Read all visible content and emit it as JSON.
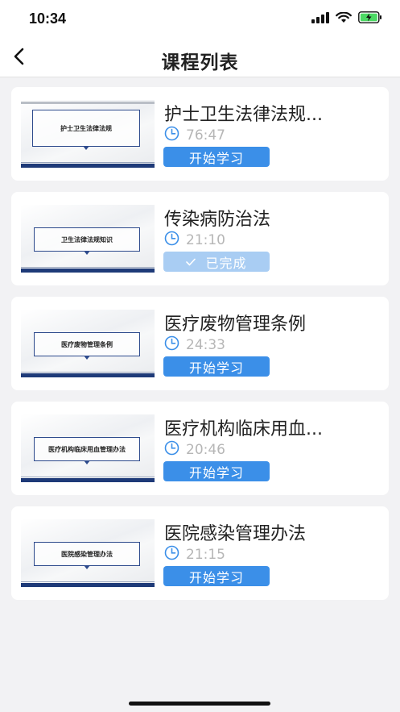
{
  "status_bar": {
    "time": "10:34"
  },
  "nav": {
    "title": "课程列表",
    "back_icon": "chevron-left-icon"
  },
  "courses": [
    {
      "thumb_text": "护士卫生法律法规",
      "title": "护士卫生法律法规...",
      "duration": "76:47",
      "action": "开始学习",
      "completed": false
    },
    {
      "thumb_text": "卫生法律法规知识",
      "title": "传染病防治法",
      "duration": "21:10",
      "action": "已完成",
      "completed": true
    },
    {
      "thumb_text": "医疗废物管理条例",
      "title": "医疗废物管理条例",
      "duration": "24:33",
      "action": "开始学习",
      "completed": false
    },
    {
      "thumb_text": "医疗机构临床用血管理办法",
      "title": "医疗机构临床用血...",
      "duration": "20:46",
      "action": "开始学习",
      "completed": false
    },
    {
      "thumb_text": "医院感染管理办法",
      "title": "医院感染管理办法",
      "duration": "21:15",
      "action": "开始学习",
      "completed": false
    }
  ],
  "colors": {
    "accent": "#3b8fe8",
    "accent_disabled": "#a9cdf3",
    "background": "#f2f2f4"
  }
}
